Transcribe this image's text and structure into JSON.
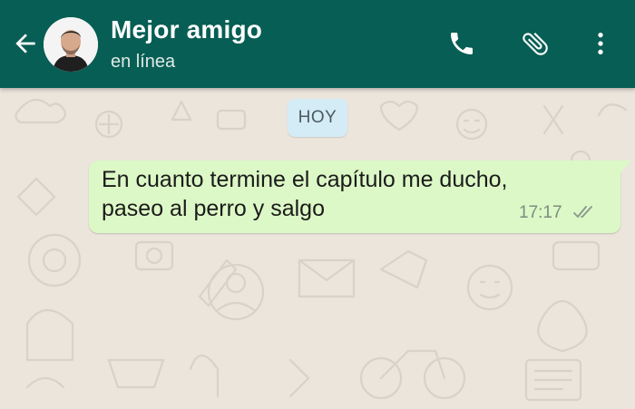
{
  "header": {
    "contact_name": "Mejor amigo",
    "status": "en línea",
    "back_icon": "arrow-back-icon",
    "call_icon": "phone-icon",
    "attach_icon": "paperclip-icon",
    "menu_icon": "more-vert-icon",
    "colors": {
      "background": "#075e54",
      "text": "#ffffff"
    }
  },
  "chat": {
    "date_separator": "HOY",
    "messages": [
      {
        "direction": "outgoing",
        "lines": [
          "En cuanto termine el capítulo me ducho,",
          "paseo al perro y salgo"
        ],
        "time": "17:17",
        "status_icon": "double-check-icon",
        "bubble_color": "#dcf8c6"
      }
    ]
  }
}
